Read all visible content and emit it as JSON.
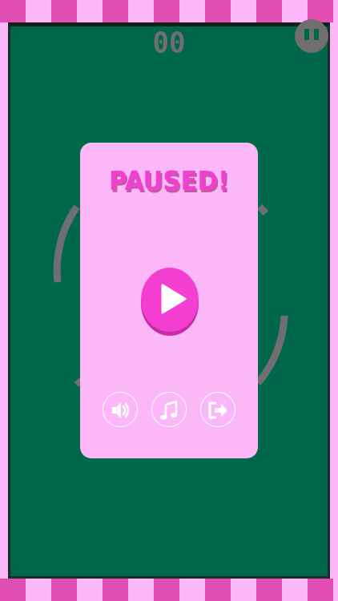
{
  "score": "00",
  "pause_menu": {
    "title": "PAUSED!"
  },
  "icons": {
    "pause": "pause-icon",
    "play": "play-icon",
    "sound": "speaker-icon",
    "music": "music-note-icon",
    "exit": "exit-arrow-icon"
  },
  "colors": {
    "frame_pink": "#fbb7f7",
    "stripe_pink": "#e24fb4",
    "game_bg": "#00674a",
    "accent_magenta": "#f23fd2",
    "ring_gray": "#6f6f6f",
    "panel_pink": "#fbb7f7"
  }
}
